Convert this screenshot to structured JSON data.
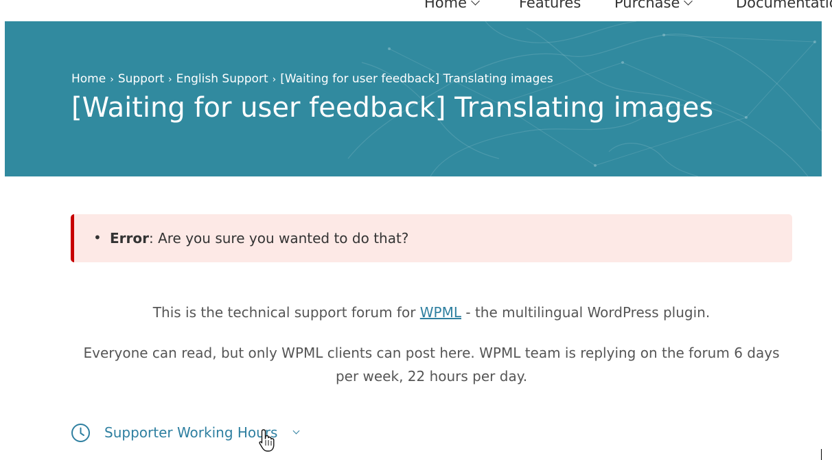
{
  "nav": {
    "items": [
      {
        "label": "Home",
        "has_dropdown": true
      },
      {
        "label": "Features",
        "has_dropdown": false
      },
      {
        "label": "Purchase",
        "has_dropdown": true
      },
      {
        "label": "Documentation",
        "has_dropdown": false
      }
    ]
  },
  "hero": {
    "background_color": "#318a9f",
    "breadcrumb": [
      "Home",
      "Support",
      "English Support",
      "[Waiting for user feedback] Translating images"
    ],
    "title": "[Waiting for user feedback] Translating images"
  },
  "notice": {
    "accent_color": "#c70000",
    "background_color": "#fde9e6",
    "label": "Error",
    "message": ": Are you sure you wanted to do that?"
  },
  "intro": {
    "line1_before": "This is the technical support forum for ",
    "line1_link": "WPML",
    "line1_after": " - the multilingual WordPress plugin.",
    "line2": "Everyone can read, but only WPML clients can post here. WPML team is replying on the forum 6 days per week, 22 hours per day."
  },
  "hours": {
    "icon": "clock-icon",
    "label": "Supporter Working Hours"
  }
}
